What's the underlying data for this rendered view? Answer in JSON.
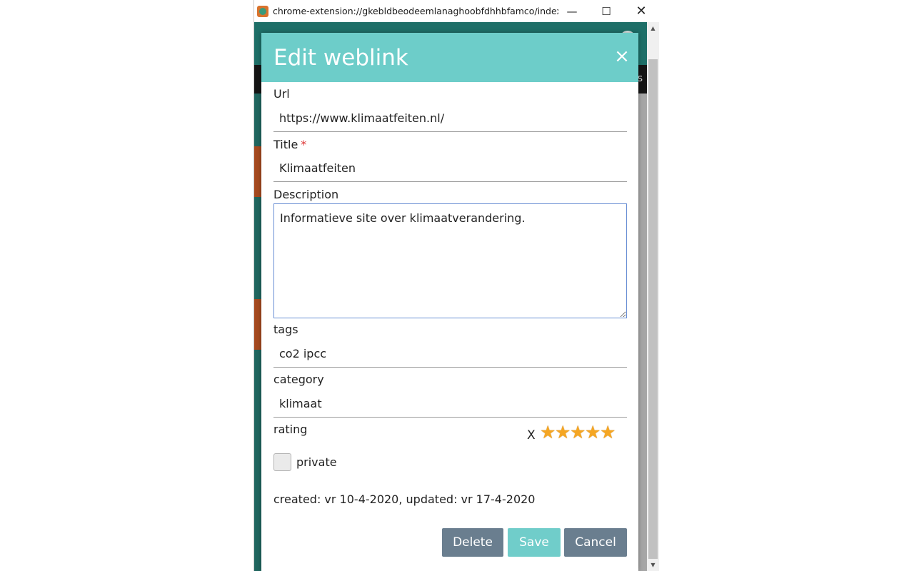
{
  "window": {
    "title": "chrome-extension://gkebldbeodeemlanaghoobfdhhbfamco/index.h...",
    "minimize_label": "—",
    "maximize_label": "☐",
    "close_label": "✕"
  },
  "background": {
    "nav_text": "gs"
  },
  "dialog": {
    "title": "Edit weblink",
    "close_label": "×",
    "url_label": "Url",
    "url_value": "https://www.klimaatfeiten.nl/",
    "title_label": "Title",
    "title_required": "*",
    "title_value": "Klimaatfeiten",
    "description_label": "Description",
    "description_value": "Informatieve site over klimaatverandering.",
    "tags_label": "tags",
    "tags_value": "co2 ipcc",
    "category_label": "category",
    "category_value": "klimaat",
    "rating_label": "rating",
    "rating_clear": "X",
    "rating_value": 5,
    "rating_max": 5,
    "private_label": "private",
    "private_checked": false,
    "meta": "created: vr 10-4-2020, updated: vr 17-4-2020",
    "buttons": {
      "delete": "Delete",
      "save": "Save",
      "cancel": "Cancel"
    }
  },
  "colors": {
    "header": "#6dcdc9",
    "button_gray": "#6a7e8f",
    "button_save": "#70cdca",
    "star": "#f5a623"
  }
}
